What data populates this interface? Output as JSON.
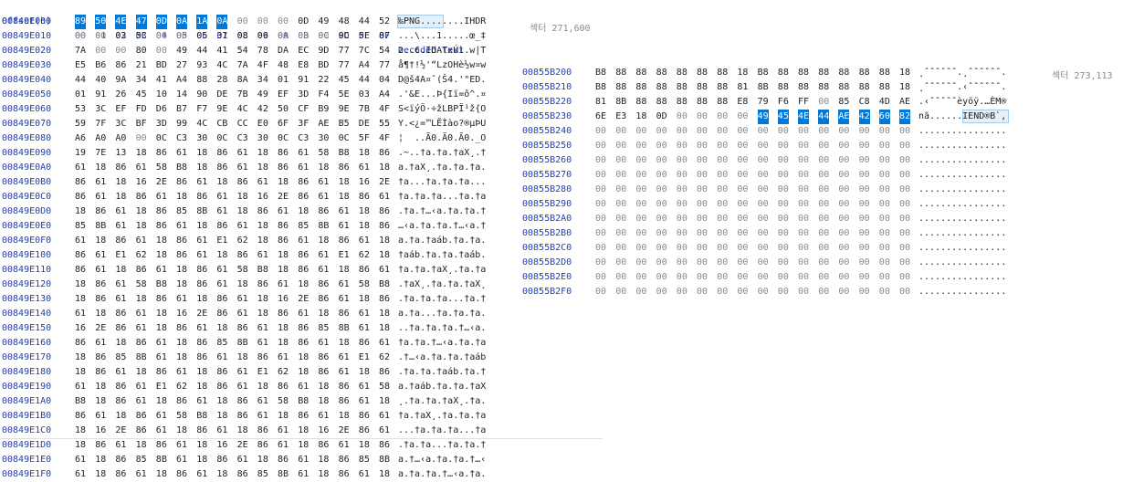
{
  "header": {
    "offset_label": "Offset(h)",
    "columns": [
      "00",
      "01",
      "02",
      "03",
      "04",
      "05",
      "06",
      "07",
      "08",
      "09",
      "0A",
      "0B",
      "0C",
      "0D",
      "0E",
      "0F"
    ],
    "decoded_label": "Decoded text"
  },
  "left_label": "섹터 271,600",
  "right_label": "섹터 273,113",
  "left_rows": [
    {
      "offset": "00849E000",
      "bytes": "89 50 4E 47 0D 0A 1A 0A 00 00 00 0D 49 48 44 52",
      "text": "‰PNG........IHDR"
    },
    {
      "offset": "00849E010",
      "bytes": "00 00 03 5C 00 00 05 31 08 06 00 00 00 9C 5F 87",
      "text": "...\\...1.....œ_‡"
    },
    {
      "offset": "00849E020",
      "bytes": "7A 00 00 80 00 49 44 41 54 78 DA EC 9D 77 7C 54",
      "text": "z..€.IDATxÚì.w|T"
    },
    {
      "offset": "00849E030",
      "bytes": "E5 B6 86 21 BD 27 93 4C 7A 4F 48 E8 BD 77 A4 77",
      "text": "å¶†!½'“LzOHè½w¤w"
    },
    {
      "offset": "00849E040",
      "bytes": "44 40 9A 34 41 A4 88 28 8A 34 01 91 22 45 44 04",
      "text": "D@š4A¤ˆ(Š4.'\"ED."
    },
    {
      "offset": "00849E050",
      "bytes": "01 91 26 45 10 14 90 DE 7B 49 EF 3D F4 5E 03 A4",
      "text": ".'&E...Þ{Iï=ô^.¤"
    },
    {
      "offset": "00849E060",
      "bytes": "53 3C EF FD D6 B7 F7 9E 4C 42 50 CF B9 9E 7B 4F",
      "text": "S<ïýÖ·÷žLBPÏ¹ž{O"
    },
    {
      "offset": "00849E070",
      "bytes": "59 7F 3C BF 3D 99 4C CB CC E0 6F 3F AE B5 DE 55",
      "text": "Y.<¿=™LËÌào?®µÞU"
    },
    {
      "offset": "00849E080",
      "bytes": "A6 A0 A0 00 0C C3 30 0C C3 30 0C C3 30 0C 5F 4F",
      "text": "¦  ..Ã0.Ã0.Ã0._O"
    },
    {
      "offset": "00849E090",
      "bytes": "19 7E 13 18 86 61 18 86 61 18 86 61 58 B8 18 86",
      "text": ".~..†a.†a.†aX¸.†"
    },
    {
      "offset": "00849E0A0",
      "bytes": "61 18 86 61 58 B8 18 86 61 18 86 61 18 86 61 18",
      "text": "a.†aX¸.†a.†a.†a."
    },
    {
      "offset": "00849E0B0",
      "bytes": "86 61 18 16 2E 86 61 18 86 61 18 86 61 18 16 2E",
      "text": "†a...†a.†a.†a..."
    },
    {
      "offset": "00849E0C0",
      "bytes": "86 61 18 86 61 18 86 61 18 16 2E 86 61 18 86 61",
      "text": "†a.†a.†a...†a.†a"
    },
    {
      "offset": "00849E0D0",
      "bytes": "18 86 61 18 86 85 8B 61 18 86 61 18 86 61 18 86",
      "text": ".†a.†…‹a.†a.†a.†"
    },
    {
      "offset": "00849E0E0",
      "bytes": "85 8B 61 18 86 61 18 86 61 18 86 85 8B 61 18 86",
      "text": "…‹a.†a.†a.†…‹a.†"
    },
    {
      "offset": "00849E0F0",
      "bytes": "61 18 86 61 18 86 61 E1 62 18 86 61 18 86 61 18",
      "text": "a.†a.†aáb.†a.†a."
    },
    {
      "offset": "00849E100",
      "bytes": "86 61 E1 62 18 86 61 18 86 61 18 86 61 E1 62 18",
      "text": "†aáb.†a.†a.†aáb."
    },
    {
      "offset": "00849E110",
      "bytes": "86 61 18 86 61 18 86 61 58 B8 18 86 61 18 86 61",
      "text": "†a.†a.†aX¸.†a.†a"
    },
    {
      "offset": "00849E120",
      "bytes": "18 86 61 58 B8 18 86 61 18 86 61 18 86 61 58 B8",
      "text": ".†aX¸.†a.†a.†aX¸"
    },
    {
      "offset": "00849E130",
      "bytes": "18 86 61 18 86 61 18 86 61 18 16 2E 86 61 18 86",
      "text": ".†a.†a.†a...†a.†"
    },
    {
      "offset": "00849E140",
      "bytes": "61 18 86 61 18 16 2E 86 61 18 86 61 18 86 61 18",
      "text": "a.†a...†a.†a.†a."
    },
    {
      "offset": "00849E150",
      "bytes": "16 2E 86 61 18 86 61 18 86 61 18 86 85 8B 61 18",
      "text": "..†a.†a.†a.†…‹a."
    },
    {
      "offset": "00849E160",
      "bytes": "86 61 18 86 61 18 86 85 8B 61 18 86 61 18 86 61",
      "text": "†a.†a.†…‹a.†a.†a"
    },
    {
      "offset": "00849E170",
      "bytes": "18 86 85 8B 61 18 86 61 18 86 61 18 86 61 E1 62",
      "text": ".†…‹a.†a.†a.†aáb"
    },
    {
      "offset": "00849E180",
      "bytes": "18 86 61 18 86 61 18 86 61 E1 62 18 86 61 18 86",
      "text": ".†a.†a.†aáb.†a.†"
    },
    {
      "offset": "00849E190",
      "bytes": "61 18 86 61 E1 62 18 86 61 18 86 61 18 86 61 58",
      "text": "a.†aáb.†a.†a.†aX"
    },
    {
      "offset": "00849E1A0",
      "bytes": "B8 18 86 61 18 86 61 18 86 61 58 B8 18 86 61 18",
      "text": "¸.†a.†a.†aX¸.†a."
    },
    {
      "offset": "00849E1B0",
      "bytes": "86 61 18 86 61 58 B8 18 86 61 18 86 61 18 86 61",
      "text": "†a.†aX¸.†a.†a.†a"
    },
    {
      "offset": "00849E1C0",
      "bytes": "18 16 2E 86 61 18 86 61 18 86 61 18 16 2E 86 61",
      "text": "...†a.†a.†a...†a"
    },
    {
      "offset": "00849E1D0",
      "bytes": "18 86 61 18 86 61 18 16 2E 86 61 18 86 61 18 86",
      "text": ".†a.†a...†a.†a.†"
    },
    {
      "offset": "00849E1E0",
      "bytes": "61 18 86 85 8B 61 18 86 61 18 86 61 18 86 85 8B",
      "text": "a.†…‹a.†a.†a.†…‹"
    },
    {
      "offset": "00849E1F0",
      "bytes": "61 18 86 61 18 86 61 18 86 85 8B 61 18 86 61 18",
      "text": "a.†a.†a.†…‹a.†a."
    }
  ],
  "right_rows": [
    {
      "offset": "00855B200",
      "bytes": "B8 88 88 88 88 88 88 18 B8 88 88 88 88 88 88 18",
      "text": "¸ˆˆˆˆˆˆ.¸ˆˆˆˆˆˆ."
    },
    {
      "offset": "00855B210",
      "bytes": "B8 88 88 88 88 88 88 81 8B 88 88 88 88 88 88 18",
      "text": "¸ˆˆˆˆˆˆ.‹ˆˆˆˆˆˆ."
    },
    {
      "offset": "00855B220",
      "bytes": "81 8B 88 88 88 88 88 E8 79 F6 FF 00 85 C8 4D AE",
      "text": ".‹ˆˆˆˆˆèyöÿ.…ÈM®"
    },
    {
      "offset": "00855B230",
      "bytes": "6E E3 18 0D 00 00 00 00 49 45 4E 44 AE 42 60 82",
      "text": "nã......IEND®B`‚"
    },
    {
      "offset": "00855B240",
      "bytes": "00 00 00 00 00 00 00 00 00 00 00 00 00 00 00 00",
      "text": "................"
    },
    {
      "offset": "00855B250",
      "bytes": "00 00 00 00 00 00 00 00 00 00 00 00 00 00 00 00",
      "text": "................"
    },
    {
      "offset": "00855B260",
      "bytes": "00 00 00 00 00 00 00 00 00 00 00 00 00 00 00 00",
      "text": "................"
    },
    {
      "offset": "00855B270",
      "bytes": "00 00 00 00 00 00 00 00 00 00 00 00 00 00 00 00",
      "text": "................"
    },
    {
      "offset": "00855B280",
      "bytes": "00 00 00 00 00 00 00 00 00 00 00 00 00 00 00 00",
      "text": "................"
    },
    {
      "offset": "00855B290",
      "bytes": "00 00 00 00 00 00 00 00 00 00 00 00 00 00 00 00",
      "text": "................"
    },
    {
      "offset": "00855B2A0",
      "bytes": "00 00 00 00 00 00 00 00 00 00 00 00 00 00 00 00",
      "text": "................"
    },
    {
      "offset": "00855B2B0",
      "bytes": "00 00 00 00 00 00 00 00 00 00 00 00 00 00 00 00",
      "text": "................"
    },
    {
      "offset": "00855B2C0",
      "bytes": "00 00 00 00 00 00 00 00 00 00 00 00 00 00 00 00",
      "text": "................"
    },
    {
      "offset": "00855B2D0",
      "bytes": "00 00 00 00 00 00 00 00 00 00 00 00 00 00 00 00",
      "text": "................"
    },
    {
      "offset": "00855B2E0",
      "bytes": "00 00 00 00 00 00 00 00 00 00 00 00 00 00 00 00",
      "text": "................"
    },
    {
      "offset": "00855B2F0",
      "bytes": "00 00 00 00 00 00 00 00 00 00 00 00 00 00 00 00",
      "text": "................"
    }
  ],
  "selection": {
    "left_bytes_highlight_count": 8,
    "left_text_highlight_chars": 8,
    "right_row_index": 3,
    "right_bytes_highlight_start": 8,
    "right_text_highlight_start": 8
  }
}
